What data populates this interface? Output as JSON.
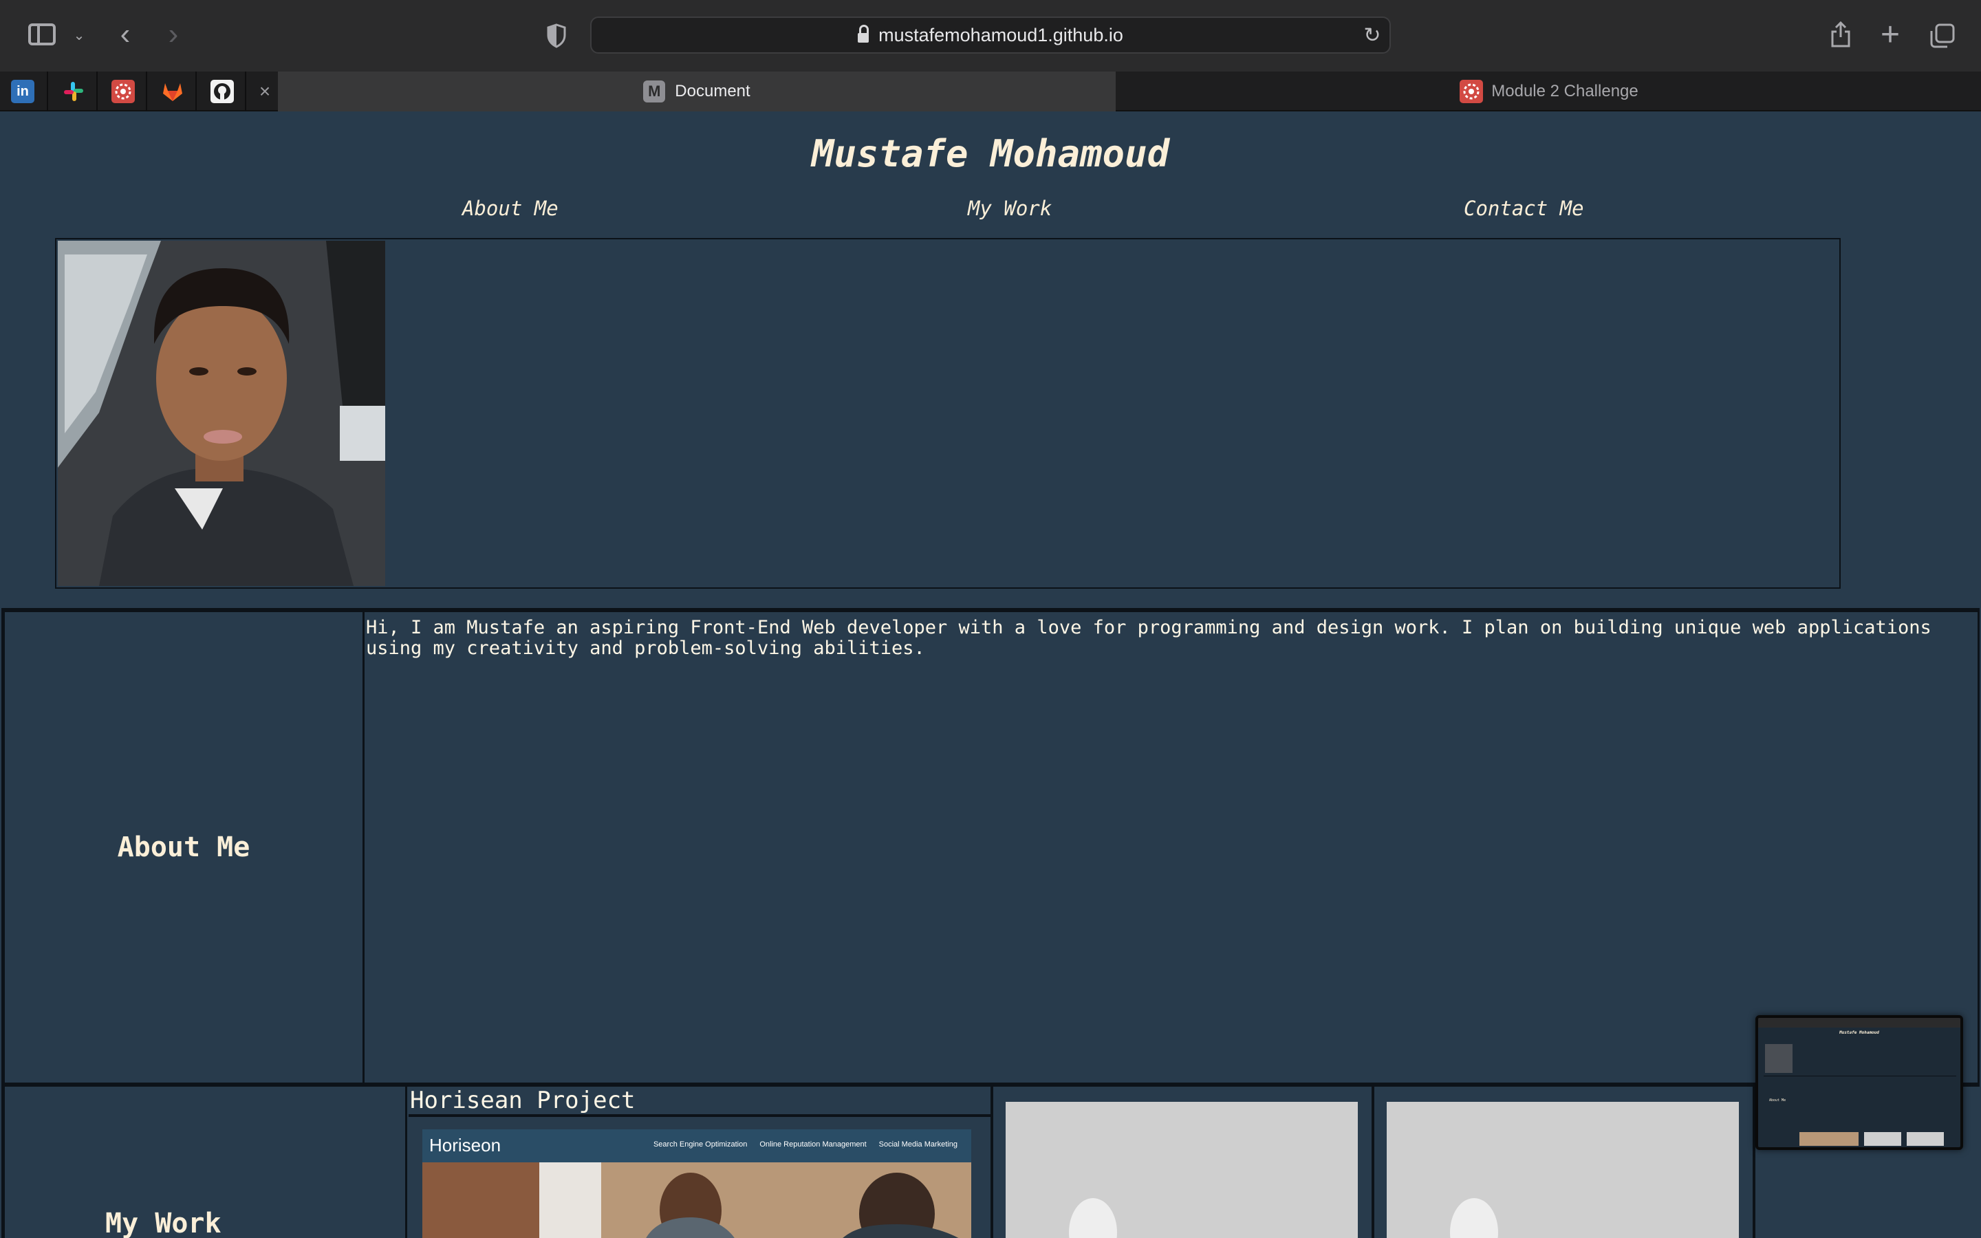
{
  "browser": {
    "url": "mustafemohamoud1.github.io",
    "bookmark_icons": [
      "linkedin-icon",
      "slack-icon",
      "bootcamp-icon",
      "gitlab-icon",
      "github-icon"
    ],
    "tabs": [
      {
        "label": "Document",
        "icon_letter": "M",
        "active": true
      },
      {
        "label": "Module 2 Challenge",
        "active": false
      }
    ]
  },
  "site": {
    "title": "Mustafe Mohamoud",
    "nav": [
      "About Me",
      "My Work",
      "Contact Me"
    ],
    "about": {
      "heading": "About Me",
      "text": "Hi, I am Mustafe an aspiring Front-End Web developer with a love for programming and design work. I plan on building unique web applications using my creativity and problem-solving abilities."
    },
    "work": {
      "heading": "My Work",
      "projects": [
        {
          "title": "Horisean Project",
          "screenshot": {
            "logo": "Horiseon",
            "links": [
              "Search Engine Optimization",
              "Online Reputation Management",
              "Social Media Marketing"
            ]
          }
        }
      ]
    }
  },
  "colors": {
    "page_bg": "#283b4c",
    "text": "#fbefd8",
    "border": "#0c1218"
  }
}
